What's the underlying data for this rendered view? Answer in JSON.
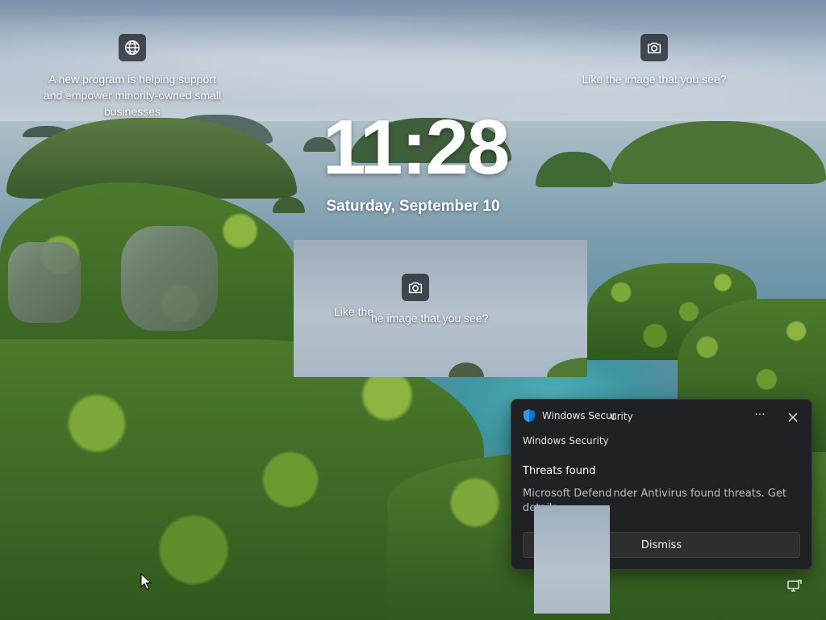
{
  "lock_screen": {
    "time": "11:28",
    "date": "Saturday, September 10"
  },
  "spotlight": {
    "left_widget": {
      "icon": "globe-icon",
      "text": "A new program is helping support and empower minority-owned small businesses",
      "lines": [
        "A new program is helping support",
        "and empower minority-owned small",
        "businesses"
      ]
    },
    "right_widget": {
      "icon": "camera-icon",
      "text": "Like the image that you see?"
    },
    "ghost_widget": {
      "icon": "camera-icon",
      "text_left": "Like the",
      "text_right": "he image that you see?"
    }
  },
  "notification": {
    "app_name": "Windows Security",
    "app_name_visible": "Windows Secur",
    "app_name_ghost": "urity",
    "source": "Windows Security",
    "title": "Threats found",
    "body_left": "Microsoft Defend",
    "body_right": "nder Antivirus found threats. Get",
    "body_line2": "details.",
    "more_label": "···",
    "dismiss_label": "Dismiss",
    "accent_color": "#0078d4"
  },
  "taskbar": {
    "tray_icon": "network-icon"
  }
}
